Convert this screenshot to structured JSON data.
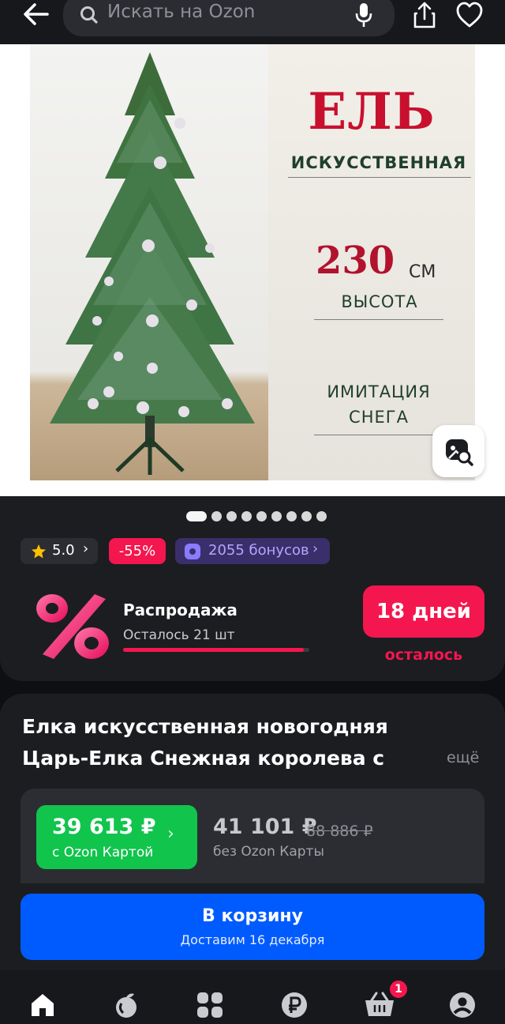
{
  "search": {
    "placeholder": "Искать на Ozon"
  },
  "icons": {
    "back": "arrow-left-icon",
    "search": "search-icon",
    "mic": "microphone-icon",
    "share": "share-icon",
    "favorite": "heart-icon",
    "lens": "image-search-icon"
  },
  "gallery": {
    "ad_title": "ЕЛЬ",
    "ad_subtitle": "ИСКУССТВЕННАЯ",
    "ad_height_value": "230",
    "ad_height_unit": "СМ",
    "ad_height_label": "ВЫСОТА",
    "ad_snow_line1": "ИМИТАЦИЯ",
    "ad_snow_line2": "СНЕГА",
    "slides_total": 9,
    "active_slide": 1
  },
  "badges": {
    "rating": "5.0",
    "rating_chevron": "›",
    "discount": "-55%",
    "bonus": "2055 бонусов",
    "bonus_chevron": "›"
  },
  "sale": {
    "title": "Распродажа",
    "remaining": "Осталось 21 шт",
    "remaining_fraction": 0.97,
    "days": "18 дней",
    "days_caption": "осталось"
  },
  "product": {
    "title_line1": "Елка искусственная новогодняя",
    "title_line2": "Царь-Елка Снежная королева с",
    "more": "ещё"
  },
  "price": {
    "card_price": "39 613 ₽",
    "card_label": "с Ozon Картой",
    "card_chevron": "›",
    "regular_price": "41 101 ₽",
    "old_price": "88 886 ₽",
    "regular_label": "без Ozon Карты"
  },
  "cart": {
    "button": "В корзину",
    "delivery": "Доставим 16 декабря"
  },
  "nav": {
    "items": [
      "home-icon",
      "fresh-icon",
      "catalog-icon",
      "finance-icon",
      "cart-icon",
      "profile-icon"
    ],
    "cart_badge": "1"
  },
  "colors": {
    "accent_pink": "#f4164e",
    "ozon_blue": "#005bff",
    "ozon_green": "#10c44c",
    "bonus_purple": "#8b7cff",
    "background": "#1c1d21"
  }
}
